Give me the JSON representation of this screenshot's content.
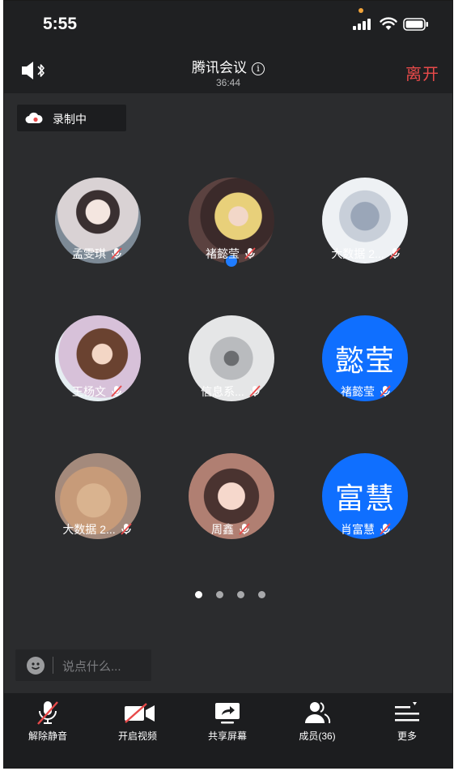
{
  "status": {
    "time": "5:55"
  },
  "header": {
    "title": "腾讯会议",
    "timer": "36:44",
    "leave_label": "离开"
  },
  "recording": {
    "label": "录制中"
  },
  "participants": [
    {
      "name": "孟雯琪",
      "avatar": "photo"
    },
    {
      "name": "褚懿莹",
      "avatar": "photo",
      "host": true
    },
    {
      "name": "大数据 2...",
      "avatar": "photo"
    },
    {
      "name": "王杨文",
      "avatar": "photo"
    },
    {
      "name": "信息系...",
      "avatar": "photo"
    },
    {
      "name": "褚懿莹",
      "avatar": "text",
      "avatar_text": "懿莹"
    },
    {
      "name": "大数据 2...",
      "avatar": "photo"
    },
    {
      "name": "周鑫",
      "avatar": "photo"
    },
    {
      "name": "肖富慧",
      "avatar": "text",
      "avatar_text": "富慧"
    }
  ],
  "pager": {
    "pages": 4,
    "current": 1
  },
  "chat": {
    "placeholder": "说点什么..."
  },
  "toolbar": {
    "unmute_label": "解除静音",
    "video_label": "开启视频",
    "share_label": "共享屏幕",
    "members_label": "成员(36)",
    "more_label": "更多"
  },
  "colors": {
    "accent_blue": "#0f6fff",
    "leave_red": "#e84a4a",
    "background": "#2b2c2e"
  }
}
